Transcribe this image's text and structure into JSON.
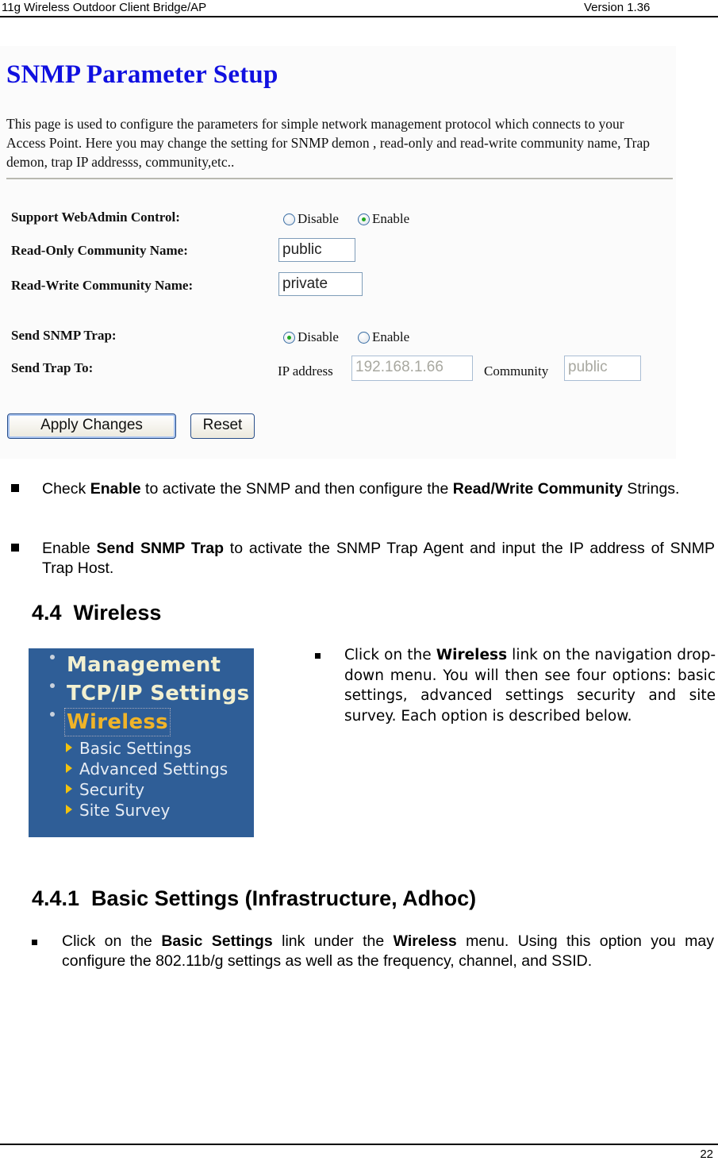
{
  "header": {
    "doc_title": "11g Wireless Outdoor Client Bridge/AP",
    "version": "Version 1.36"
  },
  "footer": {
    "page_number": "22"
  },
  "snmp_screenshot": {
    "title": "SNMP Parameter Setup",
    "description": "This page is used to configure the parameters for simple network management protocol which connects to your Access Point. Here you may change the setting for SNMP demon , read-only and read-write community name, Trap demon, trap IP addresss, community,etc..",
    "fields": {
      "webadmin": {
        "label": "Support WebAdmin Control:",
        "options": [
          "Disable",
          "Enable"
        ],
        "selected": "Enable"
      },
      "read_only": {
        "label": "Read-Only Community Name:",
        "value": "public"
      },
      "read_write": {
        "label": "Read-Write Community Name:",
        "value": "private"
      },
      "send_trap": {
        "label": "Send SNMP Trap:",
        "options": [
          "Disable",
          "Enable"
        ],
        "selected": "Disable"
      },
      "trap_to": {
        "label": "Send Trap To:",
        "ip_label": "IP address",
        "ip_value": "192.168.1.66",
        "community_label": "Community",
        "community_value": "public"
      }
    },
    "buttons": {
      "apply": "Apply Changes",
      "reset": "Reset"
    }
  },
  "bullets_snmp": [
    {
      "pre": "Check ",
      "b1": "Enable",
      "mid": " to activate the SNMP and then configure the ",
      "b2": "Read/Write Community",
      "post": " Strings."
    },
    {
      "pre": "Enable ",
      "b1": "Send SNMP Trap",
      "post": " to activate the SNMP Trap Agent and input the IP address of SNMP Trap Host."
    }
  ],
  "section_wireless": {
    "heading": "4.4  Wireless",
    "bullet": {
      "pre": "Click on the ",
      "b1": "Wireless",
      "post": " link on the navigation drop-down menu. You will then see four options: basic settings, advanced settings security and site survey. Each option is described below."
    },
    "nav_menu": {
      "top_items": [
        "Management",
        "TCP/IP Settings",
        "Wireless"
      ],
      "active": "Wireless",
      "sub_items": [
        "Basic Settings",
        "Advanced Settings",
        "Security",
        "Site Survey"
      ]
    }
  },
  "section_basic": {
    "heading": "4.4.1  Basic Settings (Infrastructure, Adhoc)",
    "bullet": {
      "pre": "Click on the ",
      "b1": "Basic Settings",
      "mid": " link under the ",
      "b2": "Wireless",
      "post": " menu. Using this option you may configure the 802.11b/g settings as well as the frequency, channel, and SSID."
    }
  }
}
